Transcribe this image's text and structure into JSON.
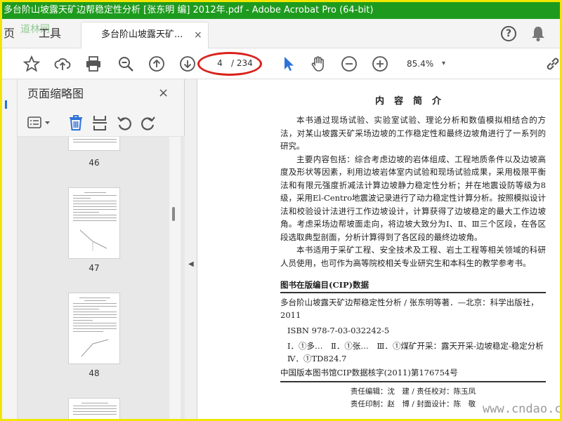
{
  "window": {
    "title": "多台阶山坡露天矿边帮稳定性分析 [张东明 编] 2012年.pdf - Adobe Acrobat Pro (64-bit)",
    "watermark_top": "道林网"
  },
  "tabs": {
    "home_label": "页",
    "tools_label": "工具",
    "document_label": "多台阶山坡露天矿...",
    "close_glyph": "×",
    "help_glyph": "?"
  },
  "toolbar": {
    "current_page": "4",
    "total_pages": "/ 234",
    "zoom": "85.4%",
    "zoom_caret": "▾"
  },
  "thumbnails": {
    "title": "页面缩略图",
    "close_glyph": "×",
    "pages": [
      {
        "number": "46"
      },
      {
        "number": "47"
      },
      {
        "number": "48"
      }
    ]
  },
  "document": {
    "heading": "内容简介",
    "paragraphs": [
      "本书通过现场试验、实验室试验、理论分析和数值模拟相结合的方法，对某山坡露天矿采场边坡的工作稳定性和最终边坡角进行了一系列的研究。",
      "主要内容包括：综合考虑边坡的岩体组成、工程地质条件以及边坡高度及形状等因素，利用边坡岩体室内试验和现场试验成果，采用极限平衡法和有限元强度折减法计算边坡静力稳定性分析；并在地震设防等级为8级，采用El-Centro地震波记录进行了动力稳定性计算分析。按照模拟设计法和校验设计法进行工作边坡设计，计算获得了边坡稳定的最大工作边坡角。考虑采场边帮坡面走向，将边坡大致分为Ⅰ、Ⅱ、Ⅲ三个区段，在各区段选取典型剖面，分析计算得到了各区段的最终边坡角。",
      "本书适用于采矿工程、安全技术及工程、岩土工程等相关领域的科研人员使用，也可作为高等院校相关专业研究生和本科生的教学参考书。"
    ],
    "cip_title": "图书在版编目(CIP)数据",
    "cip_line1": "多台阶山坡露天矿边帮稳定性分析 / 张东明等著．—北京：科学出版社，2011",
    "cip_isbn": "ISBN 978-7-03-032242-5",
    "cip_subjects": "Ⅰ．①多…　Ⅱ．①张…　Ⅲ．①煤矿开采：露天开采-边坡稳定-稳定分析　Ⅳ．①TD824.7",
    "cip_number": "中国版本图书馆CIP数据核字(2011)第176754号",
    "credits_line1": "责任编辑：沈　建 / 责任校对：陈玉凤",
    "credits_line2": "责任印制：赵　博 / 封面设计：陈　敬"
  },
  "watermark_bottom": "www.cndao.com",
  "colors": {
    "titlebar": "#1e9b1e",
    "highlight_oval": "#d9221c",
    "select_tool": "#2d72d9",
    "delete_icon": "#2d72d9"
  },
  "icons": [
    "star-icon",
    "cloud-upload-icon",
    "print-icon",
    "zoom-out-magnifier-icon",
    "page-up-icon",
    "page-down-icon",
    "select-cursor-icon",
    "hand-icon",
    "zoom-out-icon",
    "zoom-in-icon",
    "link-icon",
    "help-icon",
    "bell-icon",
    "page-options-icon",
    "delete-icon",
    "extract-icon",
    "rotate-ccw-icon",
    "rotate-cw-icon"
  ]
}
